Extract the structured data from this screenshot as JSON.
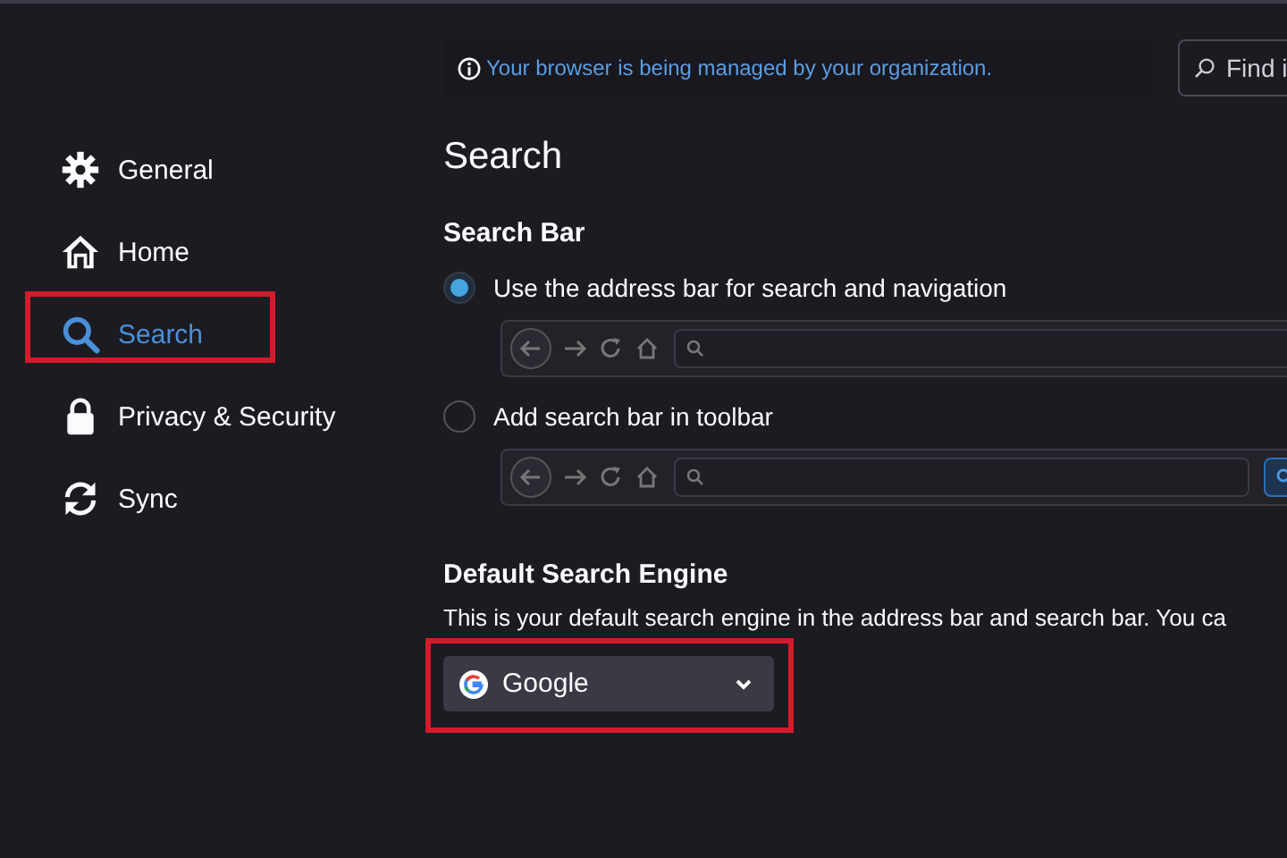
{
  "notice": {
    "text": "Your browser is being managed by your organization."
  },
  "find_field": {
    "placeholder": "Find i"
  },
  "sidebar": {
    "items": [
      {
        "label": "General",
        "selected": false,
        "highlighted": false
      },
      {
        "label": "Home",
        "selected": false,
        "highlighted": false
      },
      {
        "label": "Search",
        "selected": true,
        "highlighted": true
      },
      {
        "label": "Privacy & Security",
        "selected": false,
        "highlighted": false
      },
      {
        "label": "Sync",
        "selected": false,
        "highlighted": false
      }
    ]
  },
  "page_title": "Search",
  "search_bar": {
    "heading": "Search Bar",
    "options": [
      {
        "label": "Use the address bar for search and navigation",
        "selected": true,
        "kind": "address_bar"
      },
      {
        "label": "Add search bar in toolbar",
        "selected": false,
        "kind": "separate_search_bar"
      }
    ]
  },
  "default_engine": {
    "heading": "Default Search Engine",
    "description": "This is your default search engine in the address bar and search bar. You ca",
    "dropdown": {
      "value": "Google",
      "highlighted": true
    }
  }
}
